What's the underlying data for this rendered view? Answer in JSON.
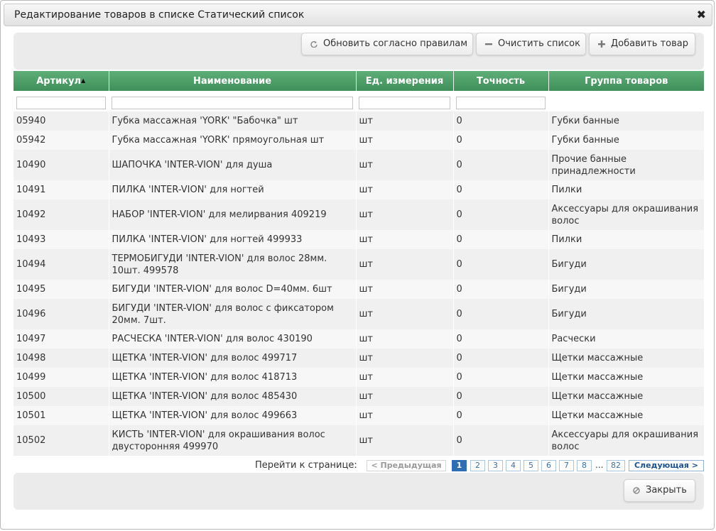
{
  "dialog": {
    "title": "Редактирование товаров в списке Статический список",
    "close_glyph": "✖"
  },
  "toolbar": {
    "refresh_label": "Обновить согласно правилам",
    "clear_label": "Очистить список",
    "add_label": "Добавить товар"
  },
  "table": {
    "headers": [
      "Артикул",
      "Наименование",
      "Ед. измерения",
      "Точность",
      "Группа товаров"
    ],
    "sort_indicator": "▲",
    "rows": [
      {
        "article": "05940",
        "name": "Губка массажная 'YORK' \"Бабочка\" шт",
        "unit": "шт",
        "precision": "0",
        "group": "Губки банные"
      },
      {
        "article": "05942",
        "name": "Губка массажная 'YORK' прямоугольная шт",
        "unit": "шт",
        "precision": "0",
        "group": "Губки банные"
      },
      {
        "article": "10490",
        "name": "ШАПОЧКА 'INTER-VION' для душа",
        "unit": "шт",
        "precision": "0",
        "group": "Прочие банные принадлежности"
      },
      {
        "article": "10491",
        "name": "ПИЛКА 'INTER-VION' для ногтей",
        "unit": "шт",
        "precision": "0",
        "group": "Пилки"
      },
      {
        "article": "10492",
        "name": "НАБОР 'INTER-VION' для мелирвания 409219",
        "unit": "шт",
        "precision": "0",
        "group": "Аксессуары для окрашивания волос"
      },
      {
        "article": "10493",
        "name": "ПИЛКА 'INTER-VION' для ногтей 499933",
        "unit": "шт",
        "precision": "0",
        "group": "Пилки"
      },
      {
        "article": "10494",
        "name": "ТЕРМОБИГУДИ 'INTER-VION' для волос 28мм. 10шт. 499578",
        "unit": "шт",
        "precision": "0",
        "group": "Бигуди"
      },
      {
        "article": "10495",
        "name": "БИГУДИ 'INTER-VION' для волос D=40мм. 6шт",
        "unit": "шт",
        "precision": "0",
        "group": "Бигуди"
      },
      {
        "article": "10496",
        "name": "БИГУДИ 'INTER-VION' для волос с фиксатором 20мм. 7шт.",
        "unit": "шт",
        "precision": "0",
        "group": "Бигуди"
      },
      {
        "article": "10497",
        "name": "РАСЧЕСКА 'INTER-VION' для волос 430190",
        "unit": "шт",
        "precision": "0",
        "group": "Расчески"
      },
      {
        "article": "10498",
        "name": "ЩЕТКА 'INTER-VION' для волос 499717",
        "unit": "шт",
        "precision": "0",
        "group": "Щетки массажные"
      },
      {
        "article": "10499",
        "name": "ЩЕТКА 'INTER-VION' для волос 418713",
        "unit": "шт",
        "precision": "0",
        "group": "Щетки массажные"
      },
      {
        "article": "10500",
        "name": "ЩЕТКА 'INTER-VION' для волос 485430",
        "unit": "шт",
        "precision": "0",
        "group": "Щетки массажные"
      },
      {
        "article": "10501",
        "name": "ЩЕТКА 'INTER-VION' для волос 499663",
        "unit": "шт",
        "precision": "0",
        "group": "Щетки массажные"
      },
      {
        "article": "10502",
        "name": "КИСТЬ 'INTER-VION' для окрашивания волос двусторонняя 499970",
        "unit": "шт",
        "precision": "0",
        "group": "Аксессуары для окрашивания волос"
      }
    ]
  },
  "pager": {
    "label": "Перейти к странице:",
    "prev": "< Предыдущая",
    "pages": [
      "1",
      "2",
      "3",
      "4",
      "5",
      "6",
      "7",
      "8"
    ],
    "ellipsis": "...",
    "last": "82",
    "next": "Следующая >",
    "current": "1"
  },
  "footer": {
    "close_label": "Закрыть"
  },
  "icons": {
    "refresh": "refresh-icon",
    "clear": "minus-icon",
    "add": "plus-icon",
    "close": "cancel-icon"
  },
  "colors": {
    "header_green": "#4a9a63",
    "pager_active": "#2f6eb3"
  }
}
